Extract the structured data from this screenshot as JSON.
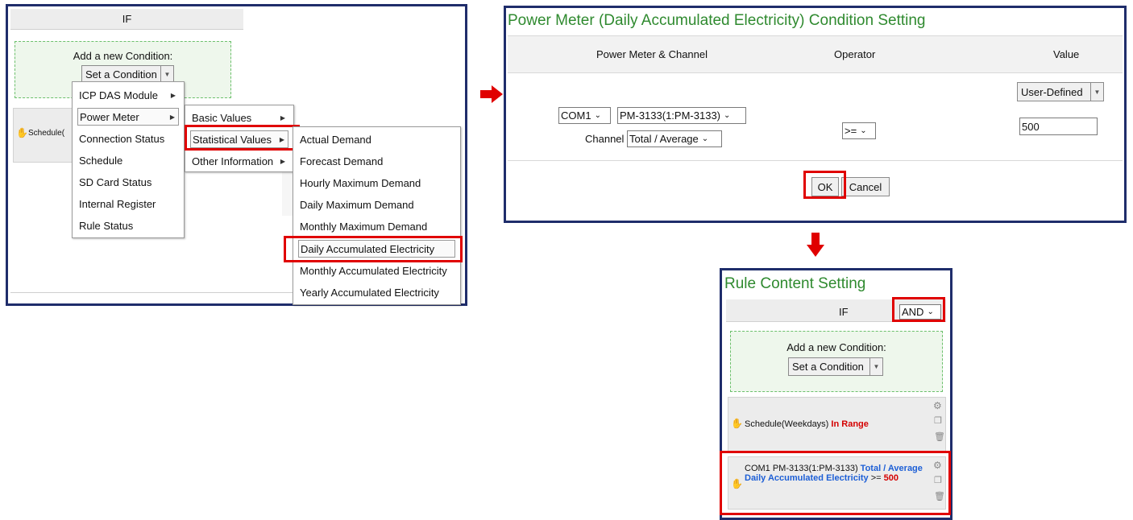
{
  "left_panel": {
    "if_header": "IF",
    "add_condition_label": "Add a new Condition:",
    "set_condition_button": "Set a Condition",
    "schedule_partial": "Schedule(",
    "menu_level1": [
      "ICP DAS Module",
      "Power Meter",
      "Connection Status",
      "Schedule",
      "SD Card Status",
      "Internal Register",
      "Rule Status"
    ],
    "menu_level2": [
      "Basic Values",
      "Statistical Values",
      "Other Information"
    ],
    "menu_level3": [
      "Actual Demand",
      "Forecast Demand",
      "Hourly Maximum Demand",
      "Daily Maximum Demand",
      "Monthly Maximum Demand",
      "Daily Accumulated Electricity",
      "Monthly Accumulated Electricity",
      "Yearly Accumulated Electricity"
    ]
  },
  "condition_dialog": {
    "title": "Power Meter (Daily Accumulated Electricity) Condition Setting",
    "col_meter": "Power Meter & Channel",
    "col_operator": "Operator",
    "col_value": "Value",
    "com_port": "COM1",
    "meter_model": "PM-3133(1:PM-3133)",
    "channel_label": "Channel",
    "channel_value": "Total / Average",
    "operator_value": ">=",
    "value_mode": "User-Defined",
    "value_input": "500",
    "ok_button": "OK",
    "cancel_button": "Cancel"
  },
  "rule_panel": {
    "title": "Rule Content Setting",
    "if_header": "IF",
    "logic_value": "AND",
    "add_condition_label": "Add a new Condition:",
    "set_condition_button": "Set a Condition",
    "condition1": {
      "name": "Schedule(Weekdays)",
      "state": "In Range"
    },
    "condition2": {
      "prefix": "COM1 PM-3133(1:PM-3133)",
      "channel": "Total / Average",
      "item": "Daily Accumulated Electricity",
      "operator": ">=",
      "value": "500"
    }
  },
  "colors": {
    "panel_border": "#1f2d6b",
    "highlight": "#e00000",
    "title_green": "#2f8a2f",
    "link_blue": "#1d5fd6",
    "dashed_green": "#6cc06c"
  }
}
